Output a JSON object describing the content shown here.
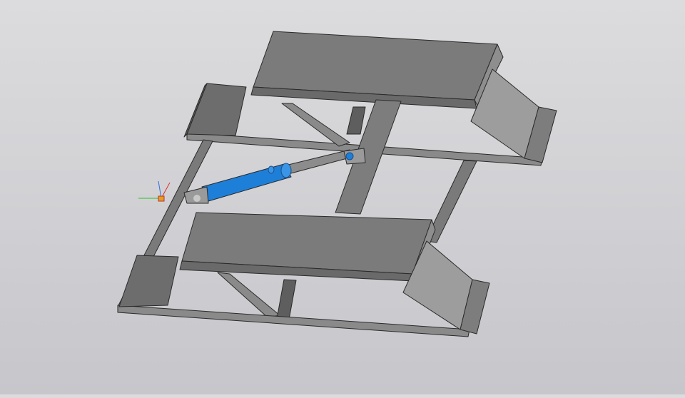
{
  "viewport": {
    "model": "scissor-lift-platform",
    "colors": {
      "background": "#d4d4d7",
      "steel_top": "#7a7a7a",
      "steel_side": "#5e5e5e",
      "steel_light": "#9c9c9c",
      "cylinder": "#1e7fd8",
      "axis_x": "#e03030",
      "axis_y": "#30c030",
      "axis_z": "#3070e0"
    }
  }
}
